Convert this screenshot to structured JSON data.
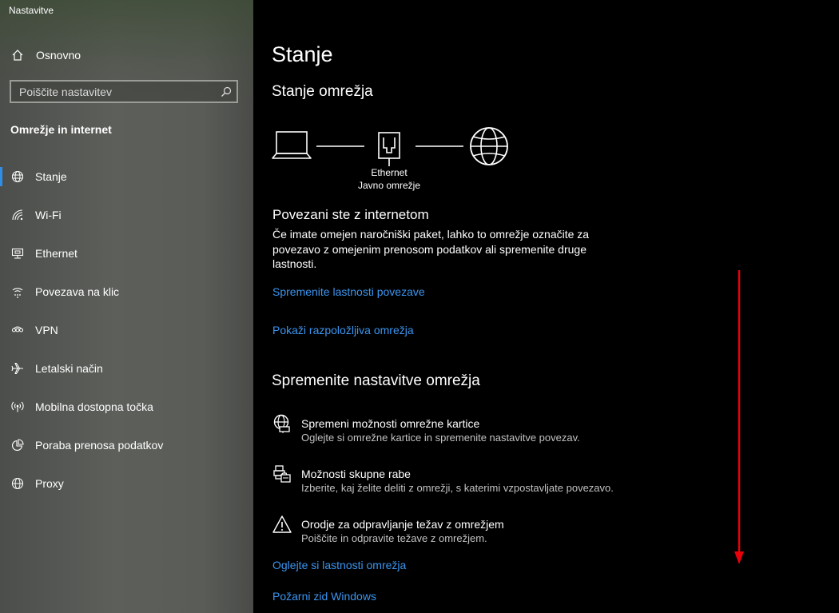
{
  "app": {
    "title": "Nastavitve"
  },
  "sidebar": {
    "home_label": "Osnovno",
    "search_placeholder": "Poiščite nastavitev",
    "section_title": "Omrežje in internet",
    "items": [
      {
        "label": "Stanje",
        "icon": "globe-network-icon",
        "active": true
      },
      {
        "label": "Wi-Fi",
        "icon": "wifi-icon"
      },
      {
        "label": "Ethernet",
        "icon": "ethernet-icon"
      },
      {
        "label": "Povezava na klic",
        "icon": "dialup-icon"
      },
      {
        "label": "VPN",
        "icon": "vpn-icon"
      },
      {
        "label": "Letalski način",
        "icon": "airplane-icon"
      },
      {
        "label": "Mobilna dostopna točka",
        "icon": "hotspot-icon"
      },
      {
        "label": "Poraba prenosa podatkov",
        "icon": "data-usage-icon"
      },
      {
        "label": "Proxy",
        "icon": "globe-icon"
      }
    ]
  },
  "main": {
    "title": "Stanje",
    "network_status_title": "Stanje omrežja",
    "adapter_name": "Ethernet",
    "network_type": "Javno omrežje",
    "connected_title": "Povezani ste z internetom",
    "connected_desc": "Če imate omejen naročniški paket, lahko to omrežje označite za povezavo z omejenim prenosom podatkov ali spremenite druge lastnosti.",
    "link_change_properties": "Spremenite lastnosti povezave",
    "link_show_networks": "Pokaži razpoložljiva omrežja",
    "settings_title": "Spremenite nastavitve omrežja",
    "options": [
      {
        "title": "Spremeni možnosti omrežne kartice",
        "desc": "Oglejte si omrežne kartice in spremenite nastavitve povezav.",
        "icon": "adapter-options-icon"
      },
      {
        "title": "Možnosti skupne rabe",
        "desc": "Izberite, kaj želite deliti z omrežji, s katerimi vzpostavljate povezavo.",
        "icon": "sharing-options-icon"
      },
      {
        "title": "Orodje za odpravljanje težav z omrežjem",
        "desc": "Poiščite in odpravite težave z omrežjem.",
        "icon": "warning-icon"
      }
    ],
    "link_view_properties": "Oglejte si lastnosti omrežja",
    "link_firewall": "Požarni zid Windows"
  },
  "colors": {
    "accent": "#2e8ee8",
    "link": "#3b95ef",
    "annotation_arrow": "#e8000b"
  }
}
